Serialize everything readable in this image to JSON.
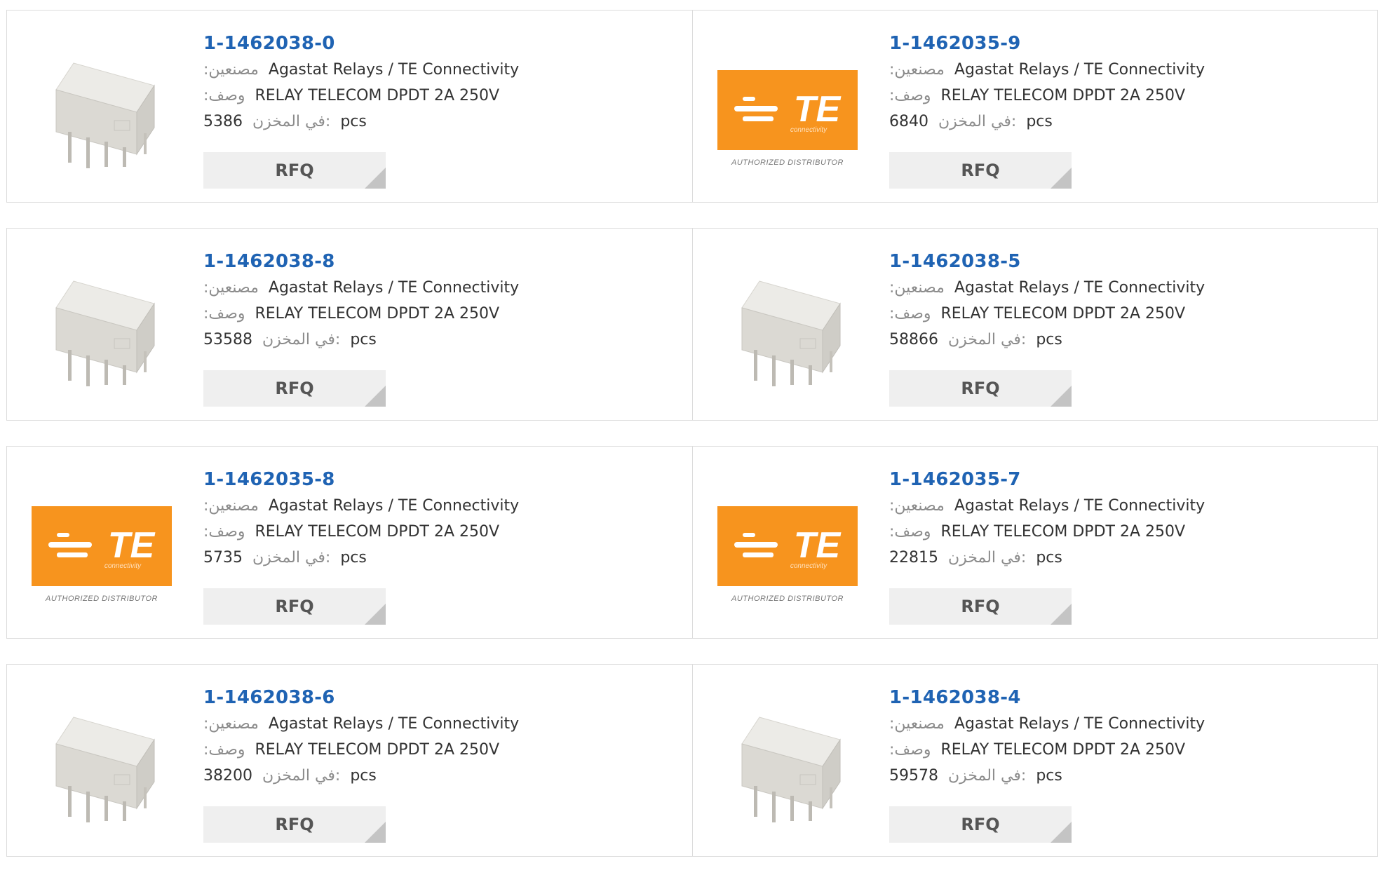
{
  "colors": {
    "part_link": "#1f63b3",
    "label": "#8c8c8c",
    "te_orange": "#f7941e",
    "rfq_bg": "#efefef"
  },
  "labels": {
    "manufacturer": ":مصنعين",
    "description": ":وصف",
    "stock": "في المخزن:",
    "unit": "pcs",
    "rfq": "RFQ"
  },
  "logo": {
    "brand": "TE",
    "sub": "connectivity",
    "caption": "AUTHORIZED DISTRIBUTOR"
  },
  "products": [
    {
      "part": "1-1462038-0",
      "manufacturer": "Agastat Relays / TE Connectivity",
      "description": "RELAY TELECOM DPDT 2A 250V",
      "stock": "5386",
      "image": "relay-image"
    },
    {
      "part": "1-1462035-9",
      "manufacturer": "Agastat Relays / TE Connectivity",
      "description": "RELAY TELECOM DPDT 2A 250V",
      "stock": "6840",
      "image": "te-logo"
    },
    {
      "part": "1-1462038-8",
      "manufacturer": "Agastat Relays / TE Connectivity",
      "description": "RELAY TELECOM DPDT 2A 250V",
      "stock": "53588",
      "image": "relay-image"
    },
    {
      "part": "1-1462038-5",
      "manufacturer": "Agastat Relays / TE Connectivity",
      "description": "RELAY TELECOM DPDT 2A 250V",
      "stock": "58866",
      "image": "relay-image"
    },
    {
      "part": "1-1462035-8",
      "manufacturer": "Agastat Relays / TE Connectivity",
      "description": "RELAY TELECOM DPDT 2A 250V",
      "stock": "5735",
      "image": "te-logo"
    },
    {
      "part": "1-1462035-7",
      "manufacturer": "Agastat Relays / TE Connectivity",
      "description": "RELAY TELECOM DPDT 2A 250V",
      "stock": "22815",
      "image": "te-logo"
    },
    {
      "part": "1-1462038-6",
      "manufacturer": "Agastat Relays / TE Connectivity",
      "description": "RELAY TELECOM DPDT 2A 250V",
      "stock": "38200",
      "image": "relay-image"
    },
    {
      "part": "1-1462038-4",
      "manufacturer": "Agastat Relays / TE Connectivity",
      "description": "RELAY TELECOM DPDT 2A 250V",
      "stock": "59578",
      "image": "relay-image"
    }
  ]
}
